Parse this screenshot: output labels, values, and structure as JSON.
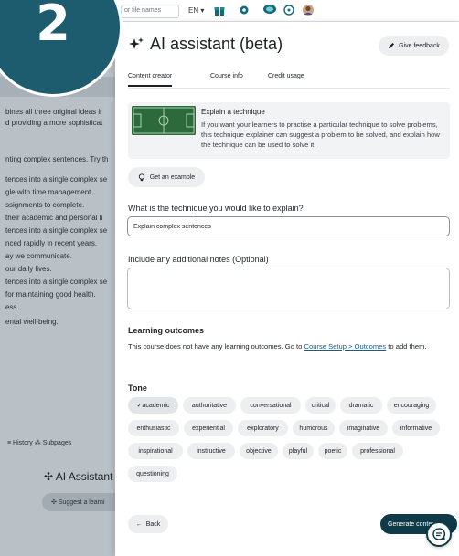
{
  "topbar": {
    "search_placeholder": "or file names",
    "language": "EN ▾",
    "icons": [
      "gift-icon",
      "gear-icon",
      "chat-bubble-icon",
      "help-icon",
      "avatar"
    ]
  },
  "background_page": {
    "lines": [
      "bines all three original ideas ir",
      "d providing a more sophisticat",
      "nting complex sentences. Try th",
      "tences into a single complex se",
      "gle with time management.",
      "ssignments to complete.",
      " their academic and personal li",
      "tences into a single complex se",
      "nced rapidly in recent years.",
      "ay we communicate.",
      "our daily lives.",
      "tences into a single complex se",
      " for maintaining good health.",
      "ess.",
      "ental well-being."
    ],
    "footer_links": "≡ History  ⁂ Subpages",
    "ai_title": "AI Assistant",
    "suggest_label": "Suggest a learni"
  },
  "step": {
    "number": "2"
  },
  "drawer": {
    "title": "AI assistant (beta)",
    "feedback_label": "Give feedback",
    "tabs": [
      {
        "label": "Content creator",
        "active": true
      },
      {
        "label": "Course info",
        "active": false
      },
      {
        "label": "Credit usage",
        "active": false
      }
    ],
    "explain": {
      "title": "Explain a technique",
      "description": "If you want your learners to practise a particular technique to solve problems, this technique explainer can suggest a problem to be solved, and explain how the technique can be used to solve it."
    },
    "example_label": "Get an example",
    "technique_label": "What is the technique you would like to explain?",
    "technique_value": "Explain complex sentences",
    "notes_label": "Include any additional notes (Optional)",
    "notes_value": "",
    "outcomes_heading": "Learning outcomes",
    "outcomes_text_before": "This course does not have any learning outcomes. Go to ",
    "outcomes_link": "Course Setup > Outcomes",
    "outcomes_text_after": " to add them.",
    "tone_heading": "Tone",
    "tones": [
      {
        "label": "academic",
        "selected": true
      },
      {
        "label": "authoritative",
        "selected": false
      },
      {
        "label": "conversational",
        "selected": false
      },
      {
        "label": "critical",
        "selected": false
      },
      {
        "label": "dramatic",
        "selected": false
      },
      {
        "label": "encouraging",
        "selected": false
      },
      {
        "label": "enthusiastic",
        "selected": false
      },
      {
        "label": "experiential",
        "selected": false
      },
      {
        "label": "exploratory",
        "selected": false
      },
      {
        "label": "humorous",
        "selected": false
      },
      {
        "label": "imaginative",
        "selected": false
      },
      {
        "label": "informative",
        "selected": false
      },
      {
        "label": "inspirational",
        "selected": false
      },
      {
        "label": "instructive",
        "selected": false
      },
      {
        "label": "objective",
        "selected": false
      },
      {
        "label": "playful",
        "selected": false
      },
      {
        "label": "poetic",
        "selected": false
      },
      {
        "label": "professional",
        "selected": false
      },
      {
        "label": "questioning",
        "selected": false
      }
    ],
    "back_label": "Back",
    "generate_label": "Generate content"
  },
  "colors": {
    "primary": "#0f3b49",
    "badge": "#1c5c6e",
    "link": "#1c5c8a",
    "chip_bg": "#eceeef"
  }
}
